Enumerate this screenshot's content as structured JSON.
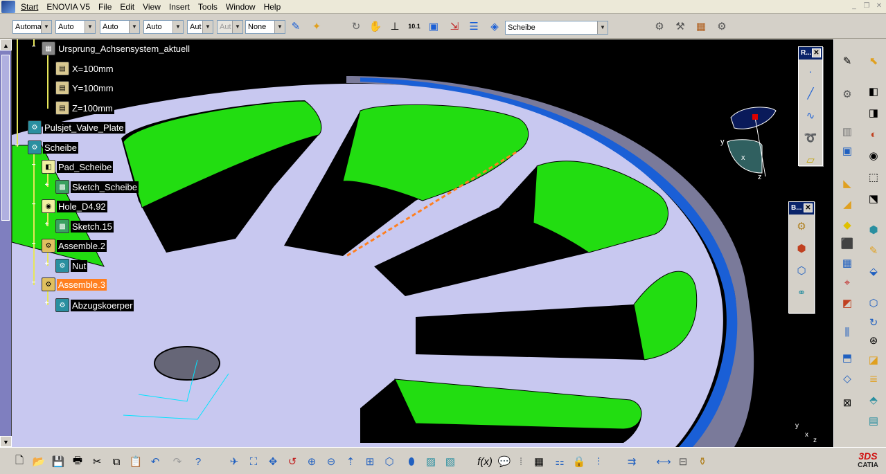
{
  "menubar": {
    "items": [
      "Start",
      "ENOVIA V5",
      "File",
      "Edit",
      "View",
      "Insert",
      "Tools",
      "Window",
      "Help"
    ]
  },
  "property_toolbar": {
    "combos": [
      "Automa",
      "Auto",
      "Auto",
      "Auto",
      "Aut",
      "Aut",
      "None"
    ],
    "layer": "Scheibe"
  },
  "spec_tree": {
    "nodes": [
      {
        "label": "Ursprung_Achsensystem_aktuell",
        "icon": "axis-system-icon"
      },
      {
        "label": "X=100mm",
        "icon": "parameter-icon"
      },
      {
        "label": "Y=100mm",
        "icon": "parameter-icon"
      },
      {
        "label": "Z=100mm",
        "icon": "parameter-icon"
      },
      {
        "label": "Pulsjet_Valve_Plate",
        "icon": "product-icon"
      },
      {
        "label": "Scheibe",
        "icon": "part-icon"
      },
      {
        "label": "Pad_Scheibe",
        "icon": "pad-icon"
      },
      {
        "label": "Sketch_Scheibe",
        "icon": "sketch-icon"
      },
      {
        "label": "Hole_D4.92",
        "icon": "hole-icon"
      },
      {
        "label": "Sketch.15",
        "icon": "sketch-icon"
      },
      {
        "label": "Assemble.2",
        "icon": "assemble-icon"
      },
      {
        "label": "Nut",
        "icon": "part-icon"
      },
      {
        "label": "Assemble.3",
        "icon": "assemble-icon",
        "selected": true
      },
      {
        "label": "Abzugskoerper",
        "icon": "part-icon"
      }
    ]
  },
  "floating_toolbars": {
    "reference": {
      "title": "R..."
    },
    "boolean": {
      "title": "B..."
    }
  },
  "compass": {
    "axis_y": "y",
    "axis_x": "x",
    "axis_z": "z"
  },
  "view_axis": {
    "y": "y",
    "x": "x",
    "z": "z"
  },
  "bottom": {
    "logo_top": "3DS",
    "logo_bottom": "CATIA"
  },
  "colors": {
    "viewport_bg": "#000000",
    "part_surface": "#c8c8f0",
    "pocket_faces": "#22dd11",
    "rim_edge": "#1a5fd6",
    "selection": "#ff7f1f",
    "tree_line": "#e6e65a"
  }
}
